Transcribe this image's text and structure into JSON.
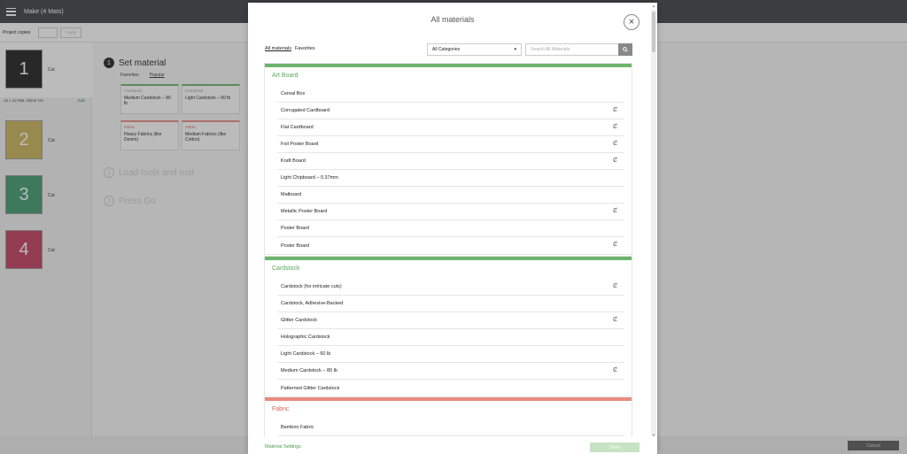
{
  "app": {
    "title": "Make (4 Mats)"
  },
  "toolbar": {
    "copies_label": "Project copies",
    "apply_label": "Apply"
  },
  "mats": [
    {
      "number": "1",
      "label": "Cut",
      "color": "#1e1e1e"
    },
    {
      "number": "2",
      "label": "Cut",
      "color": "#c9b458"
    },
    {
      "number": "3",
      "label": "Cut",
      "color": "#3f9a6e"
    },
    {
      "number": "4",
      "label": "Cut",
      "color": "#c43d5e"
    }
  ],
  "mat_info": {
    "size": "12 x 12 Mat, Mirror On",
    "edit_label": "Edit"
  },
  "steps": [
    {
      "num": "1",
      "label": "Set material"
    },
    {
      "num": "2",
      "label": "Load tools and mat"
    },
    {
      "num": "3",
      "label": "Press Go"
    }
  ],
  "mini_tabs": {
    "favorites": "Favorites",
    "popular": "Popular"
  },
  "quick_cards": [
    {
      "category": "Cardstock",
      "name": "Medium Cardstock – 80 lb"
    },
    {
      "category": "Cardstock",
      "name": "Light Cardstock – 60 lb"
    },
    {
      "category": "Fabric",
      "name": "Heavy Fabrics (like Denim)"
    },
    {
      "category": "Fabric",
      "name": "Medium Fabrics (like Cotton)"
    }
  ],
  "modal": {
    "title": "All materials",
    "tab_all": "All materials",
    "tab_fav": "Favorites",
    "category_select": "All Categories",
    "search_placeholder": "Search All Materials",
    "material_settings": "Material Settings",
    "done_label": "Done"
  },
  "sections": [
    {
      "title": "Art Board",
      "items": [
        {
          "name": "Cereal Box",
          "blade": false
        },
        {
          "name": "Corrugated Cardboard",
          "blade": true
        },
        {
          "name": "Flat Cardboard",
          "blade": true
        },
        {
          "name": "Foil Poster Board",
          "blade": true
        },
        {
          "name": "Kraft Board",
          "blade": true
        },
        {
          "name": "Light Chipboard – 0.37mm",
          "blade": false
        },
        {
          "name": "Matboard",
          "blade": false
        },
        {
          "name": "Metallic Poster Board",
          "blade": true
        },
        {
          "name": "Poster Board",
          "blade": false
        },
        {
          "name": "Poster Board",
          "blade": true
        }
      ]
    },
    {
      "title": "Cardstock",
      "items": [
        {
          "name": "Cardstock (for intricate cuts)",
          "blade": true
        },
        {
          "name": "Cardstock, Adhesive-Backed",
          "blade": false
        },
        {
          "name": "Glitter Cardstock",
          "blade": true
        },
        {
          "name": "Holographic Cardstock",
          "blade": false
        },
        {
          "name": "Light Cardstock – 60 lb",
          "blade": false
        },
        {
          "name": "Medium Cardstock – 80 lb",
          "blade": true
        },
        {
          "name": "Patterned Glitter Cardstock",
          "blade": false
        }
      ]
    },
    {
      "title": "Fabric",
      "items": [
        {
          "name": "Bamboo Fabric",
          "blade": false
        }
      ]
    }
  ],
  "footer": {
    "cancel_label": "Cancel"
  },
  "icons": {
    "blade": "blade-icon",
    "close": "close-icon",
    "search": "search-icon",
    "menu": "menu-icon"
  }
}
